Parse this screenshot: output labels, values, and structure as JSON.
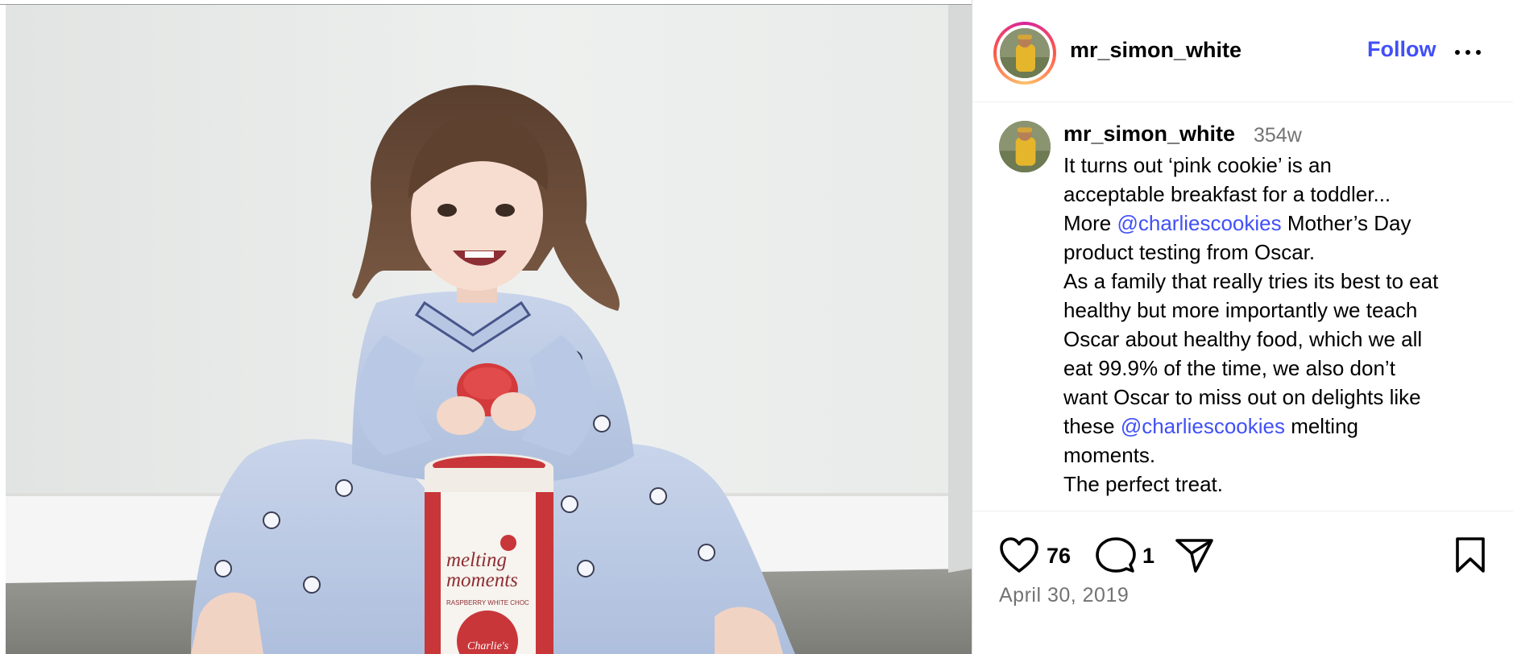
{
  "post": {
    "username": "mr_simon_white",
    "follow_label": "Follow",
    "caption": {
      "username": "mr_simon_white",
      "age": "354w",
      "lines": [
        {
          "parts": [
            {
              "t": "It turns out ‘pink cookie’ is an"
            }
          ]
        },
        {
          "parts": [
            {
              "t": "acceptable breakfast for a toddler..."
            }
          ]
        },
        {
          "parts": [
            {
              "t": "More "
            },
            {
              "t": "@charliescookies",
              "mention": true
            },
            {
              "t": " Mother’s Day"
            }
          ]
        },
        {
          "parts": [
            {
              "t": "product testing from Oscar."
            }
          ]
        },
        {
          "parts": [
            {
              "t": "As a family that really tries its best to eat"
            }
          ]
        },
        {
          "parts": [
            {
              "t": "healthy but more importantly we teach"
            }
          ]
        },
        {
          "parts": [
            {
              "t": "Oscar about healthy food, which we all"
            }
          ]
        },
        {
          "parts": [
            {
              "t": "eat 99.9% of the time, we also don’t"
            }
          ]
        },
        {
          "parts": [
            {
              "t": "want Oscar to miss out on delights like"
            }
          ]
        },
        {
          "parts": [
            {
              "t": "these "
            },
            {
              "t": "@charliescookies",
              "mention": true
            },
            {
              "t": " melting"
            }
          ]
        },
        {
          "parts": [
            {
              "t": "moments."
            }
          ]
        },
        {
          "parts": [
            {
              "t": "The perfect treat."
            }
          ]
        }
      ]
    },
    "likes": "76",
    "comments": "1",
    "date": "April 30, 2019",
    "jar_text": {
      "line1": "melting",
      "line2": "moments",
      "flavour": "RASPBERRY WHITE CHOC",
      "brand": "Charlie's"
    }
  },
  "icons": {
    "more": "more-horizontal-icon",
    "like": "heart-icon",
    "comment": "comment-icon",
    "share": "paper-plane-icon",
    "save": "bookmark-icon"
  },
  "colors": {
    "link": "#4150f7",
    "muted": "#737373",
    "divider": "#efefef"
  }
}
